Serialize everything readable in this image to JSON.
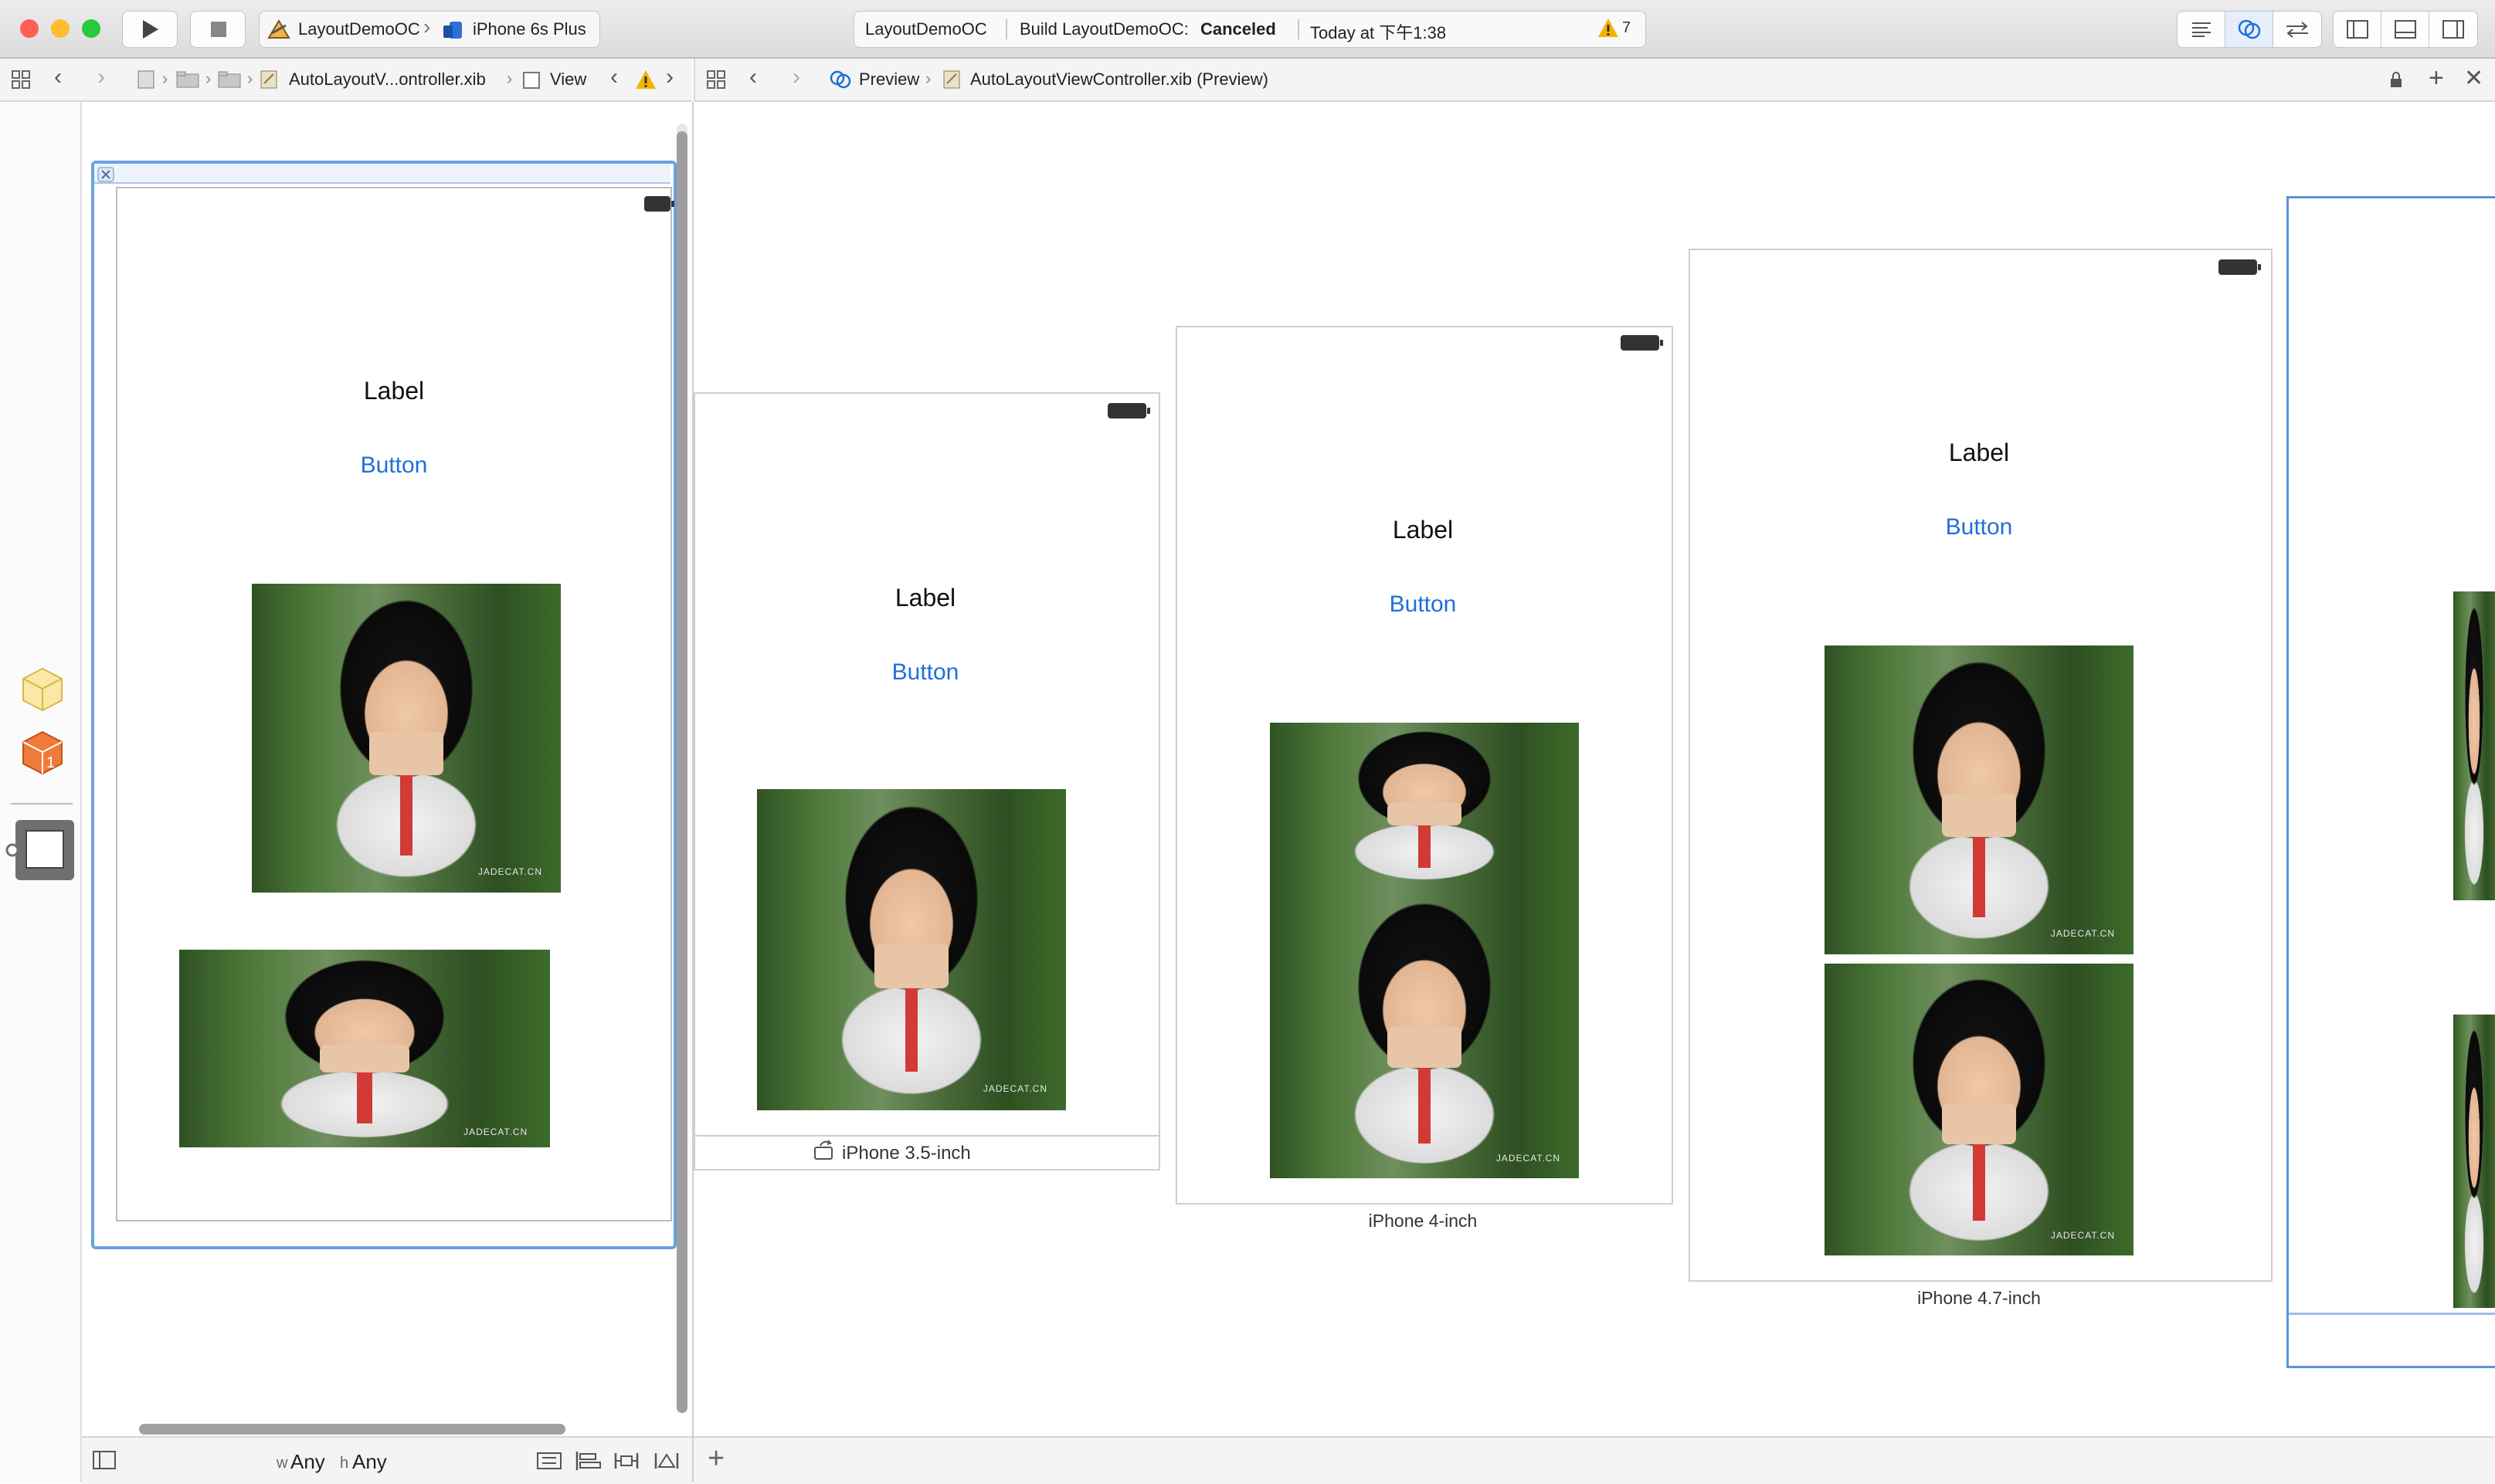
{
  "toolbar": {
    "scheme_name": "LayoutDemoOC",
    "device_name": "iPhone 6s Plus",
    "activity_project": "LayoutDemoOC",
    "activity_build_prefix": "Build LayoutDemoOC: ",
    "activity_build_status": "Canceled",
    "activity_time": "Today at 下午1:38",
    "warning_count": "7"
  },
  "left_jumpbar": {
    "file": "AutoLayoutV...ontroller.xib",
    "scope": "View"
  },
  "right_jumpbar": {
    "mode": "Preview",
    "file": "AutoLayoutViewController.xib (Preview)"
  },
  "editor": {
    "label_text": "Label",
    "button_text": "Button",
    "watermark": "JADECAT.CN"
  },
  "size_class": {
    "w_prefix": "w",
    "w_value": "Any",
    "h_prefix": "h",
    "h_value": "Any"
  },
  "previews": [
    {
      "caption": "iPhone 3.5-inch",
      "label": "Label",
      "button": "Button"
    },
    {
      "caption": "iPhone 4-inch",
      "label": "Label",
      "button": "Button"
    },
    {
      "caption": "iPhone 4.7-inch",
      "label": "Label",
      "button": "Button"
    }
  ],
  "colors": {
    "accent_blue": "#1e6fd9",
    "warning_yellow": "#f4b400",
    "close_red": "#fe5f57",
    "minimize_yellow": "#febc2e",
    "zoom_green": "#28c840"
  }
}
